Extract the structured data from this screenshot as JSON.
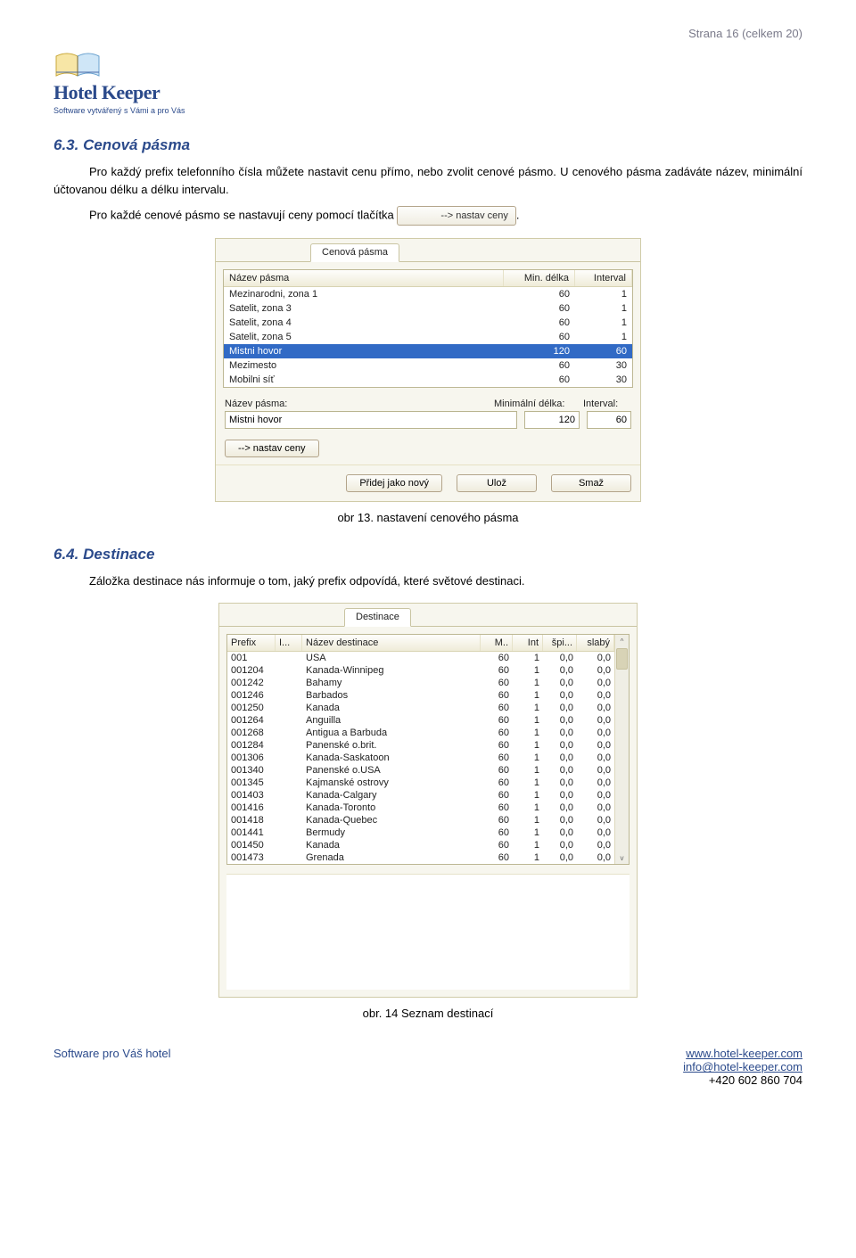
{
  "page_number": "Strana 16 (celkem 20)",
  "brand": {
    "name": "Hotel Keeper",
    "tagline": "Software vytvářený s Vámi a pro Vás"
  },
  "section_63": {
    "heading": "6.3.  Cenová pásma",
    "para1": "Pro každý prefix telefonního čísla můžete nastavit cenu přímo, nebo zvolit cenové pásmo. U cenového pásma zadáváte název, minimální účtovanou délku a délku intervalu.",
    "para2_pre": "Pro každé cenové pásmo se nastavují ceny pomocí tlačítka ",
    "inline_button": "--> nastav ceny",
    "para2_post": "."
  },
  "panel1": {
    "tab": "Cenová pásma",
    "headers": {
      "name": "Název pásma",
      "min": "Min. délka",
      "interval": "Interval"
    },
    "rows": [
      {
        "name": "Mezinarodni, zona 1",
        "min": "60",
        "interval": "1"
      },
      {
        "name": "Satelit, zona 3",
        "min": "60",
        "interval": "1"
      },
      {
        "name": "Satelit, zona 4",
        "min": "60",
        "interval": "1"
      },
      {
        "name": "Satelit, zona 5",
        "min": "60",
        "interval": "1"
      },
      {
        "name": "Mistni hovor",
        "min": "120",
        "interval": "60",
        "selected": true
      },
      {
        "name": "Mezimesto",
        "min": "60",
        "interval": "30"
      },
      {
        "name": "Mobilni síť",
        "min": "60",
        "interval": "30"
      }
    ],
    "labels": {
      "name": "Název pásma:",
      "min": "Minimální délka:",
      "interval": "Interval:"
    },
    "inputs": {
      "name": "Mistni hovor",
      "min": "120",
      "interval": "60"
    },
    "btn_nastav": "--> nastav ceny",
    "btn_add": "Přidej jako nový",
    "btn_save": "Ulož",
    "btn_delete": "Smaž"
  },
  "caption1": "obr 13. nastavení cenového pásma",
  "section_64": {
    "heading": "6.4.  Destinace",
    "para": "Záložka destinace nás informuje o tom, jaký prefix odpovídá, které světové destinaci."
  },
  "panel2": {
    "tab": "Destinace",
    "headers": {
      "prefix": "Prefix",
      "i": "I...",
      "name": "Název destinace",
      "m": "M..",
      "int": "Int",
      "spi": "špi...",
      "slab": "slabý",
      "sc": ""
    },
    "rows": [
      {
        "prefix": "001",
        "i": "",
        "name": "USA",
        "m": "60",
        "int": "1",
        "spi": "0,0",
        "slab": "0,0"
      },
      {
        "prefix": "001204",
        "i": "",
        "name": "Kanada-Winnipeg",
        "m": "60",
        "int": "1",
        "spi": "0,0",
        "slab": "0,0"
      },
      {
        "prefix": "001242",
        "i": "",
        "name": "Bahamy",
        "m": "60",
        "int": "1",
        "spi": "0,0",
        "slab": "0,0"
      },
      {
        "prefix": "001246",
        "i": "",
        "name": "Barbados",
        "m": "60",
        "int": "1",
        "spi": "0,0",
        "slab": "0,0"
      },
      {
        "prefix": "001250",
        "i": "",
        "name": "Kanada",
        "m": "60",
        "int": "1",
        "spi": "0,0",
        "slab": "0,0"
      },
      {
        "prefix": "001264",
        "i": "",
        "name": "Anguilla",
        "m": "60",
        "int": "1",
        "spi": "0,0",
        "slab": "0,0"
      },
      {
        "prefix": "001268",
        "i": "",
        "name": "Antigua a Barbuda",
        "m": "60",
        "int": "1",
        "spi": "0,0",
        "slab": "0,0"
      },
      {
        "prefix": "001284",
        "i": "",
        "name": "Panenské o.brit.",
        "m": "60",
        "int": "1",
        "spi": "0,0",
        "slab": "0,0"
      },
      {
        "prefix": "001306",
        "i": "",
        "name": "Kanada-Saskatoon",
        "m": "60",
        "int": "1",
        "spi": "0,0",
        "slab": "0,0"
      },
      {
        "prefix": "001340",
        "i": "",
        "name": "Panenské o.USA",
        "m": "60",
        "int": "1",
        "spi": "0,0",
        "slab": "0,0"
      },
      {
        "prefix": "001345",
        "i": "",
        "name": "Kajmanské ostrovy",
        "m": "60",
        "int": "1",
        "spi": "0,0",
        "slab": "0,0"
      },
      {
        "prefix": "001403",
        "i": "",
        "name": "Kanada-Calgary",
        "m": "60",
        "int": "1",
        "spi": "0,0",
        "slab": "0,0"
      },
      {
        "prefix": "001416",
        "i": "",
        "name": "Kanada-Toronto",
        "m": "60",
        "int": "1",
        "spi": "0,0",
        "slab": "0,0"
      },
      {
        "prefix": "001418",
        "i": "",
        "name": "Kanada-Quebec",
        "m": "60",
        "int": "1",
        "spi": "0,0",
        "slab": "0,0"
      },
      {
        "prefix": "001441",
        "i": "",
        "name": "Bermudy",
        "m": "60",
        "int": "1",
        "spi": "0,0",
        "slab": "0,0"
      },
      {
        "prefix": "001450",
        "i": "",
        "name": "Kanada",
        "m": "60",
        "int": "1",
        "spi": "0,0",
        "slab": "0,0"
      },
      {
        "prefix": "001473",
        "i": "",
        "name": "Grenada",
        "m": "60",
        "int": "1",
        "spi": "0,0",
        "slab": "0,0"
      }
    ],
    "scroll_head": "^"
  },
  "caption2": "obr. 14 Seznam destinací",
  "footer": {
    "left": "Software pro Váš hotel",
    "link1": "www.hotel-keeper.com",
    "link2": "info@hotel-keeper.com",
    "phone": "+420 602 860 704"
  }
}
